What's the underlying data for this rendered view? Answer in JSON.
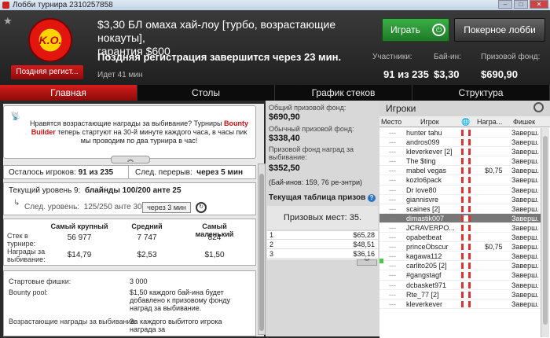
{
  "window": {
    "title": "Лобби турнира 2310257858"
  },
  "header": {
    "logo_text": "K.O.",
    "late_reg_btn": "Поздняя регист...",
    "title_line1": "$3,30 БЛ омаха хай-лоу [турбо, возрастающие нокауты],",
    "title_line2": "гарантия $600",
    "late_reg_text": "Поздняя регистрация завершится через 23 мин.",
    "elapsed": "Идет 41 мин",
    "play_btn": "Играть",
    "lobby_btn": "Покерное лобби",
    "stats": [
      {
        "label": "Участники:",
        "value": "91 из 235"
      },
      {
        "label": "Бай-ин:",
        "value": "$3,30"
      },
      {
        "label": "Призовой фонд:",
        "value": "$690,90"
      }
    ]
  },
  "tabs": [
    "Главная",
    "Столы",
    "График стеков",
    "Структура"
  ],
  "promo": {
    "pre": "Нравятся возрастающие награды за выбивание? Турниры ",
    "highlight": "Bounty Builder",
    "post": " теперь стартуют на 30-й минуте каждого часа, в часы пик мы проводим по два турнира в час!"
  },
  "status": {
    "players_label": "Осталось игроков:",
    "players_value": "91 из 235",
    "break_label": "След. перерыв:",
    "break_value": "через 5 мин"
  },
  "level": {
    "current_label": "Текущий уровень 9:",
    "current_value": "блайнды 100/200 анте 25",
    "next_label": "След. уровень:",
    "next_value": "125/250 анте 30",
    "next_btn": "через 3 мин"
  },
  "stacks": {
    "headers": [
      "Самый крупный",
      "Средний",
      "Самый маленький"
    ],
    "row1_label": "Стек в турнире:",
    "row1": [
      "56 977",
      "7 747",
      "824"
    ],
    "row2_label": "Награды за выбивание:",
    "row2": [
      "$14,79",
      "$2,53",
      "$1,50"
    ]
  },
  "info": [
    {
      "label": "Стартовые фишки:",
      "value": "3 000"
    },
    {
      "label": "Bounty pool:",
      "value": "$1,50 каждого бай-ина будет добавлено к призовому фонду наград за выбивание."
    },
    {
      "label": "Возрастающие награды за выбивание:",
      "value": "За каждого выбитого игрока награда за"
    }
  ],
  "prize": {
    "total_label": "Общий призовой фонд:",
    "total": "$690,90",
    "regular_label": "Обычный призовой фонд:",
    "regular": "$338,40",
    "bounty_label": "Призовой фонд наград за выбивание:",
    "bounty": "$352,50",
    "buyins": "(Бай-инов: 159, 76 ре-энтри)",
    "table_link": "Текущая таблица призов",
    "places": "Призовых мест: 35.",
    "rows": [
      {
        "n": "1",
        "v": "$65,28"
      },
      {
        "n": "2",
        "v": "$48,51"
      },
      {
        "n": "3",
        "v": "$36,16"
      }
    ]
  },
  "players": {
    "title": "Игроки",
    "columns": [
      "Место",
      "Игрок",
      "Награ...",
      "Фишек"
    ],
    "list": [
      {
        "place": "---",
        "name": "hunter tahu",
        "bounty": "",
        "status": "Заверш."
      },
      {
        "place": "---",
        "name": "andros099",
        "bounty": "",
        "status": "Заверш."
      },
      {
        "place": "---",
        "name": "kleverkever [2]",
        "bounty": "",
        "status": "Заверш."
      },
      {
        "place": "---",
        "name": "The $ting",
        "bounty": "",
        "status": "Заверш."
      },
      {
        "place": "---",
        "name": "mabel vegas",
        "bounty": "$0,75",
        "status": "Заверш."
      },
      {
        "place": "---",
        "name": "kozlo6pack",
        "bounty": "",
        "status": "Заверш."
      },
      {
        "place": "---",
        "name": "Dr love80",
        "bounty": "",
        "status": "Заверш."
      },
      {
        "place": "---",
        "name": "giannisvre",
        "bounty": "",
        "status": "Заверш."
      },
      {
        "place": "---",
        "name": "scaines [2]",
        "bounty": "",
        "status": "Заверш."
      },
      {
        "place": "---",
        "name": "dimastik007",
        "bounty": "",
        "status": "Заверш.",
        "selected": true
      },
      {
        "place": "---",
        "name": "JCRAVERPO...",
        "bounty": "",
        "status": "Заверш."
      },
      {
        "place": "---",
        "name": "opabetbeat",
        "bounty": "",
        "status": "Заверш."
      },
      {
        "place": "---",
        "name": "princeObscur",
        "bounty": "$0,75",
        "status": "Заверш."
      },
      {
        "place": "---",
        "name": "kagawa112",
        "bounty": "",
        "status": "Заверш."
      },
      {
        "place": "---",
        "name": "carlito205 [2]",
        "bounty": "",
        "status": "Заверш."
      },
      {
        "place": "---",
        "name": "#gangstagf",
        "bounty": "",
        "status": "Заверш."
      },
      {
        "place": "---",
        "name": "dcbasket971",
        "bounty": "",
        "status": "Заверш."
      },
      {
        "place": "---",
        "name": "Rte_77 [2]",
        "bounty": "",
        "status": "Заверш."
      },
      {
        "place": "---",
        "name": "kleverkever",
        "bounty": "",
        "status": "Заверш."
      }
    ]
  }
}
